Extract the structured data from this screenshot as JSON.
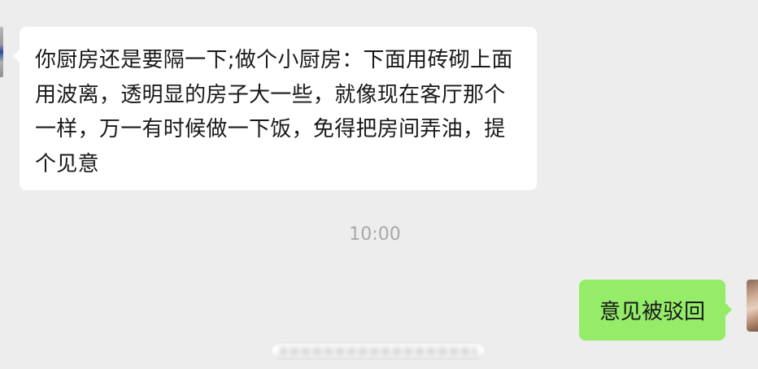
{
  "messages": [
    {
      "side": "left",
      "text": "你厨房还是要隔一下;做个小厨房：下面用砖砌上面用波离，透明显的房子大一些，就像现在客厅那个一样，万一有时候做一下饭，免得把房间弄油，提个见意"
    },
    {
      "side": "right",
      "text": "意见被驳回"
    }
  ],
  "timestamp": "10:00",
  "colors": {
    "background": "#ededed",
    "incoming_bubble": "#ffffff",
    "outgoing_bubble": "#95ec69",
    "timestamp_text": "#a8a8a8"
  }
}
